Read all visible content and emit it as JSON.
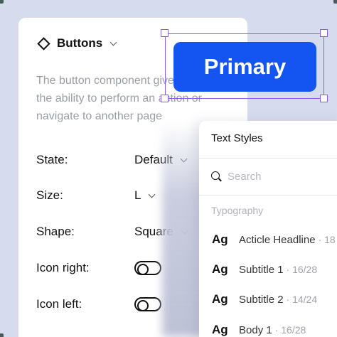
{
  "buttons_panel": {
    "title": "Buttons",
    "description": "The button component gives users the ability to perform an action or navigate to another page",
    "properties": [
      {
        "label": "State:",
        "value": "Default",
        "kind": "dropdown"
      },
      {
        "label": "Size:",
        "value": "L",
        "kind": "dropdown"
      },
      {
        "label": "Shape:",
        "value": "Square",
        "kind": "dropdown"
      },
      {
        "label": "Icon right:",
        "value": "",
        "kind": "toggle",
        "on": false
      },
      {
        "label": "Icon left:",
        "value": "",
        "kind": "toggle",
        "on": false
      }
    ]
  },
  "canvas": {
    "primary_button_label": "Primary",
    "accent_color": "#1454f0",
    "selection_color": "#8b5cf6"
  },
  "text_styles": {
    "title": "Text Styles",
    "search_placeholder": "Search",
    "section_label": "Typography",
    "items": [
      {
        "sample": "Ag",
        "name": "Acticle Headline",
        "meta": "· 18"
      },
      {
        "sample": "Ag",
        "name": "Subtitle 1",
        "meta": "· 16/28"
      },
      {
        "sample": "Ag",
        "name": "Subtitle 2",
        "meta": "· 14/24"
      },
      {
        "sample": "Ag",
        "name": "Body 1",
        "meta": "· 16/28"
      }
    ]
  }
}
